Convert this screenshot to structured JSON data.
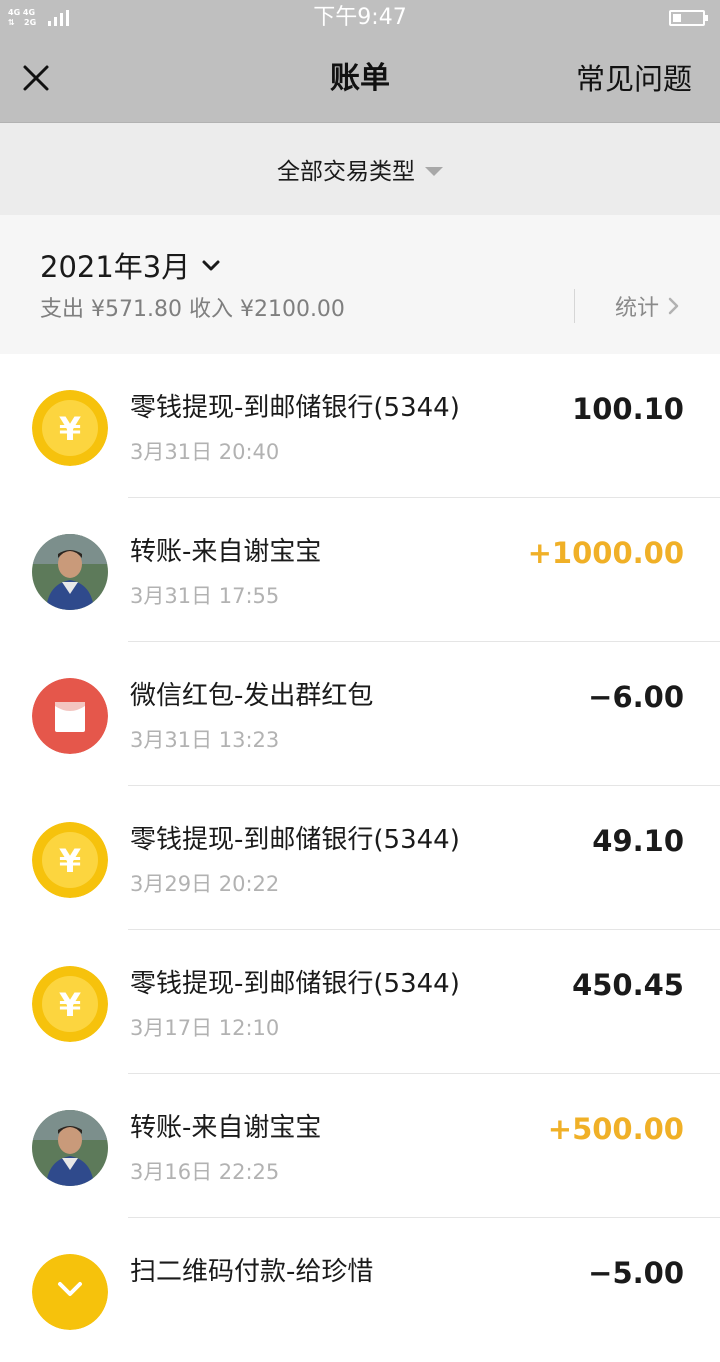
{
  "status_bar": {
    "network_top": "4G 4G",
    "network_bottom": "2G",
    "time": "下午9:47"
  },
  "header": {
    "title": "账单",
    "faq_label": "常见问题"
  },
  "filter": {
    "label": "全部交易类型"
  },
  "month": {
    "label": "2021年3月",
    "summary": "支出 ¥571.80 收入 ¥2100.00",
    "stats_label": "统计"
  },
  "colors": {
    "income": "#f0b027",
    "coin": "#f6c20c",
    "red_packet": "#e5574b"
  },
  "transactions": [
    {
      "icon": "yuan-coin-icon",
      "title": "零钱提现-到邮储银行(5344)",
      "time": "3月31日 20:40",
      "amount": "100.10",
      "type": "neutral"
    },
    {
      "icon": "avatar",
      "title": "转账-来自谢宝宝",
      "time": "3月31日 17:55",
      "amount": "+1000.00",
      "type": "income"
    },
    {
      "icon": "red-packet-icon",
      "title": "微信红包-发出群红包",
      "time": "3月31日 13:23",
      "amount": "−6.00",
      "type": "neutral"
    },
    {
      "icon": "yuan-coin-icon",
      "title": "零钱提现-到邮储银行(5344)",
      "time": "3月29日 20:22",
      "amount": "49.10",
      "type": "neutral"
    },
    {
      "icon": "yuan-coin-icon",
      "title": "零钱提现-到邮储银行(5344)",
      "time": "3月17日 12:10",
      "amount": "450.45",
      "type": "neutral"
    },
    {
      "icon": "avatar",
      "title": "转账-来自谢宝宝",
      "time": "3月16日 22:25",
      "amount": "+500.00",
      "type": "income"
    },
    {
      "icon": "scan-pay-icon",
      "title": "扫二维码付款-给珍惜",
      "time": "",
      "amount": "−5.00",
      "type": "neutral"
    }
  ]
}
